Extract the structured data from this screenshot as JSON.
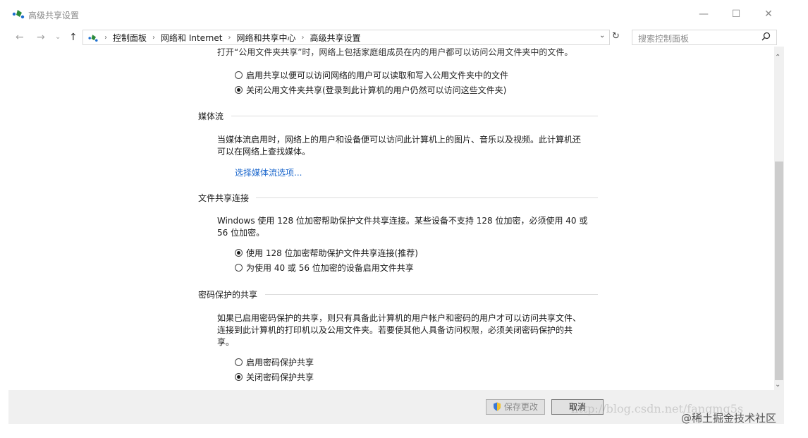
{
  "window": {
    "title": "高级共享设置",
    "minimize_glyph": "—",
    "maximize_glyph": "☐",
    "close_glyph": "✕"
  },
  "nav": {
    "back_glyph": "←",
    "forward_glyph": "→",
    "recent_glyph": "⌄",
    "up_glyph": "↑"
  },
  "address": {
    "crumbs": [
      "控制面板",
      "网络和 Internet",
      "网络和共享中心",
      "高级共享设置"
    ],
    "separator": "›",
    "dropdown_glyph": "⌄",
    "refresh_glyph": "↻"
  },
  "search": {
    "placeholder": "搜索控制面板",
    "icon": "search-icon"
  },
  "public_folder": {
    "intro": "打开“公用文件夹共享”时，网络上包括家庭组成员在内的用户都可以访问公用文件夹中的文件。",
    "options": [
      {
        "label": "启用共享以便可以访问网络的用户可以读取和写入公用文件夹中的文件",
        "selected": false
      },
      {
        "label": "关闭公用文件夹共享(登录到此计算机的用户仍然可以访问这些文件夹)",
        "selected": true
      }
    ]
  },
  "media": {
    "heading": "媒体流",
    "desc_line1": "当媒体流启用时，网络上的用户和设备便可以访问此计算机上的图片、音乐以及视频。此计算机还",
    "desc_line2": "可以在网络上查找媒体。",
    "link": "选择媒体流选项..."
  },
  "file_sharing": {
    "heading": "文件共享连接",
    "desc_line1": "Windows 使用 128 位加密帮助保护文件共享连接。某些设备不支持 128 位加密，必须使用 40 或",
    "desc_line2": "56 位加密。",
    "options": [
      {
        "label": "使用 128 位加密帮助保护文件共享连接(推荐)",
        "selected": true
      },
      {
        "label": "为使用 40 或 56 位加密的设备启用文件共享",
        "selected": false
      }
    ]
  },
  "password": {
    "heading": "密码保护的共享",
    "desc_line1": "如果已启用密码保护的共享，则只有具备此计算机的用户帐户和密码的用户才可以访问共享文件、",
    "desc_line2": "连接到此计算机的打印机以及公用文件夹。若要使其他人具备访问权限，必须关闭密码保护的共",
    "desc_line3": "享。",
    "options": [
      {
        "label": "启用密码保护共享",
        "selected": false
      },
      {
        "label": "关闭密码保护共享",
        "selected": true
      }
    ]
  },
  "scrollbar": {
    "up_glyph": "⌃",
    "down_glyph": "⌄"
  },
  "footer": {
    "save_label": "保存更改",
    "cancel_label": "取消"
  },
  "watermarks": {
    "csdn": "http://blog.csdn.net/fangmg5s",
    "juejin": "@稀土掘金技术社区"
  },
  "colors": {
    "link": "#1a66cc",
    "accent_icon": "#2a8a3a"
  }
}
